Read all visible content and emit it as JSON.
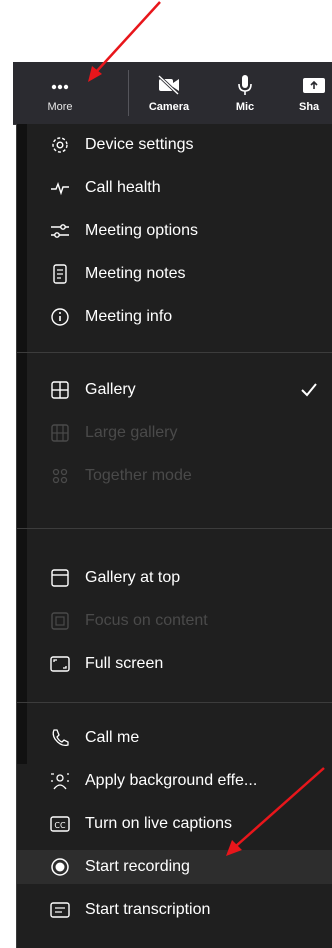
{
  "toolbar": {
    "more_label": "More",
    "camera_label": "Camera",
    "mic_label": "Mic",
    "share_label": "Sha"
  },
  "menu": {
    "device_settings": "Device settings",
    "call_health": "Call health",
    "meeting_options": "Meeting options",
    "meeting_notes": "Meeting notes",
    "meeting_info": "Meeting info",
    "gallery": "Gallery",
    "large_gallery": "Large gallery",
    "together_mode": "Together mode",
    "gallery_at_top": "Gallery at top",
    "focus_on_content": "Focus on content",
    "full_screen": "Full screen",
    "call_me": "Call me",
    "apply_background_effects": "Apply background effe...",
    "live_captions": "Turn on live captions",
    "start_recording": "Start recording",
    "start_transcription": "Start transcription"
  },
  "colors": {
    "menu_background": "#1f1f1f",
    "toolbar_background": "#2b2b30",
    "disabled_text": "#4a4a4a",
    "annotation_arrow": "#e8161b"
  },
  "states": {
    "gallery_checked": true,
    "hovered_item": "start_recording"
  }
}
